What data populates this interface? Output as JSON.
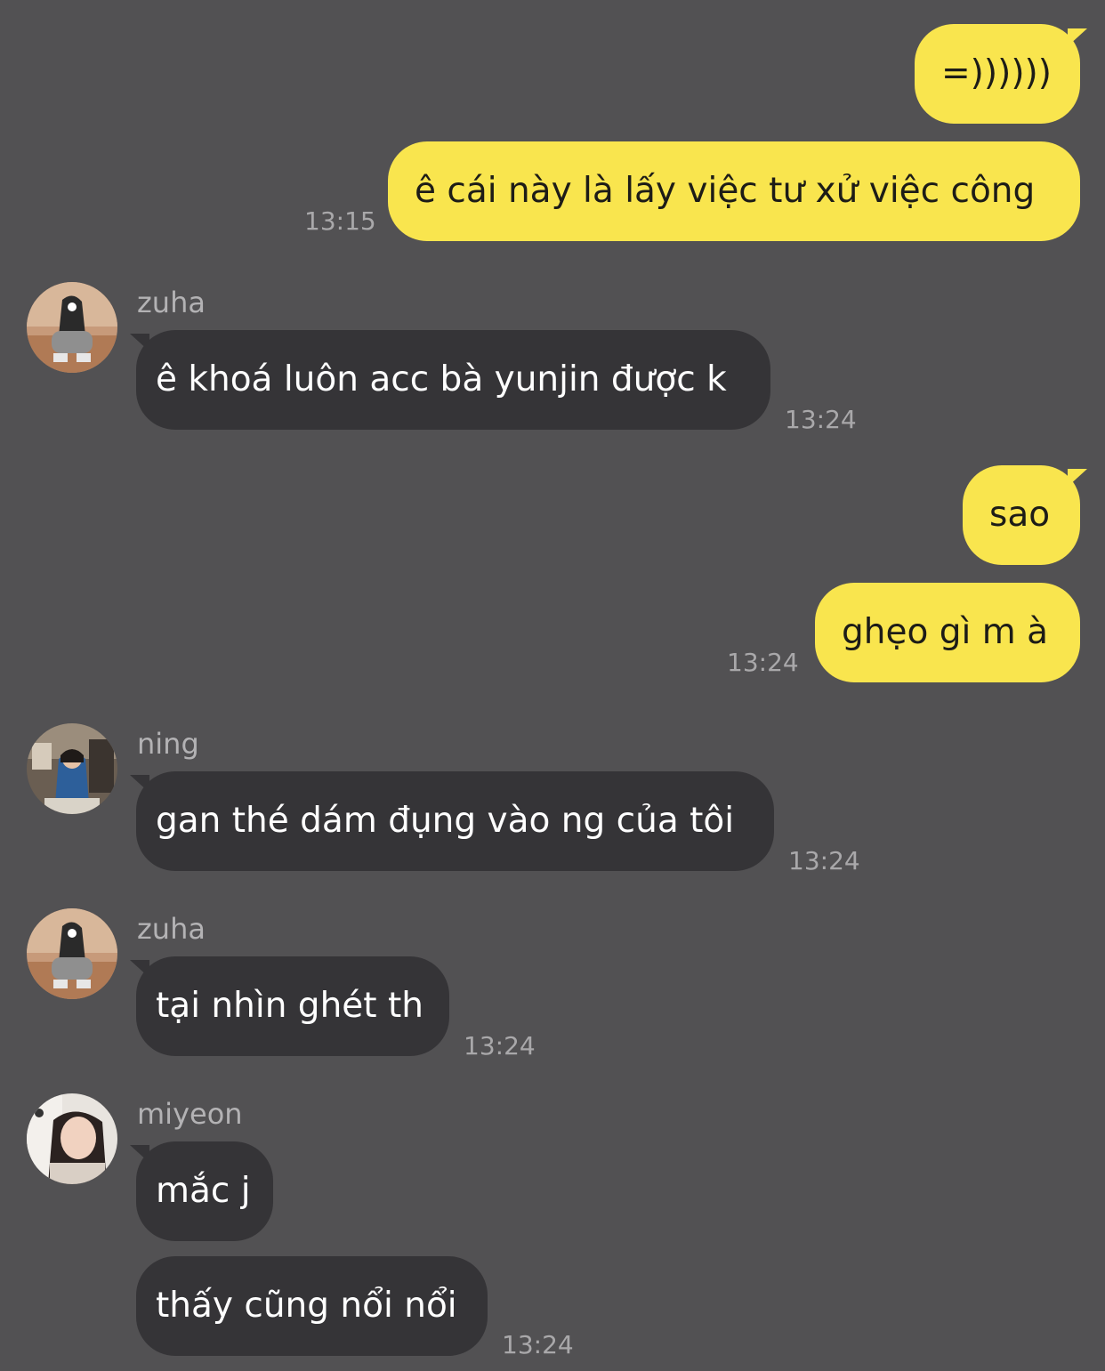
{
  "colors": {
    "background": "#525153",
    "outgoing_bubble": "#f9e54e",
    "incoming_bubble": "#353437",
    "timestamp": "#a9a8aa"
  },
  "messages": {
    "out1": {
      "text": "=))))))"
    },
    "out2": {
      "text": "ê cái này là lấy việc tư xử việc công",
      "time": "13:15"
    },
    "zuha1": {
      "sender": "zuha",
      "text": "ê khoá luôn acc bà yunjin được k",
      "time": "13:24"
    },
    "out3": {
      "text": "sao"
    },
    "out4": {
      "text": "ghẹo gì m à",
      "time": "13:24"
    },
    "ning": {
      "sender": "ning",
      "text": "gan thé dám đụng vào ng của tôi",
      "time": "13:24"
    },
    "zuha2": {
      "sender": "zuha",
      "text": "tại nhìn ghét th",
      "time": "13:24"
    },
    "miyeon1": {
      "sender": "miyeon",
      "text": "mắc j"
    },
    "miyeon2": {
      "text": "thấy cũng nổi nổi",
      "time": "13:24"
    }
  }
}
